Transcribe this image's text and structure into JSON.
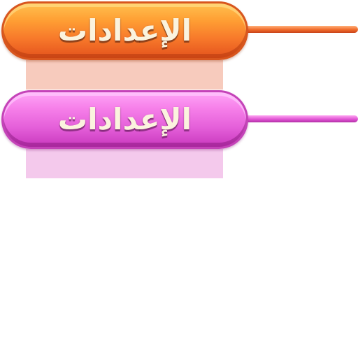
{
  "buttons": [
    {
      "id": "orange",
      "label": "الإعدادات",
      "color": "#f7782a"
    },
    {
      "id": "pink",
      "label": "الإعدادات",
      "color": "#e45fd9"
    }
  ]
}
